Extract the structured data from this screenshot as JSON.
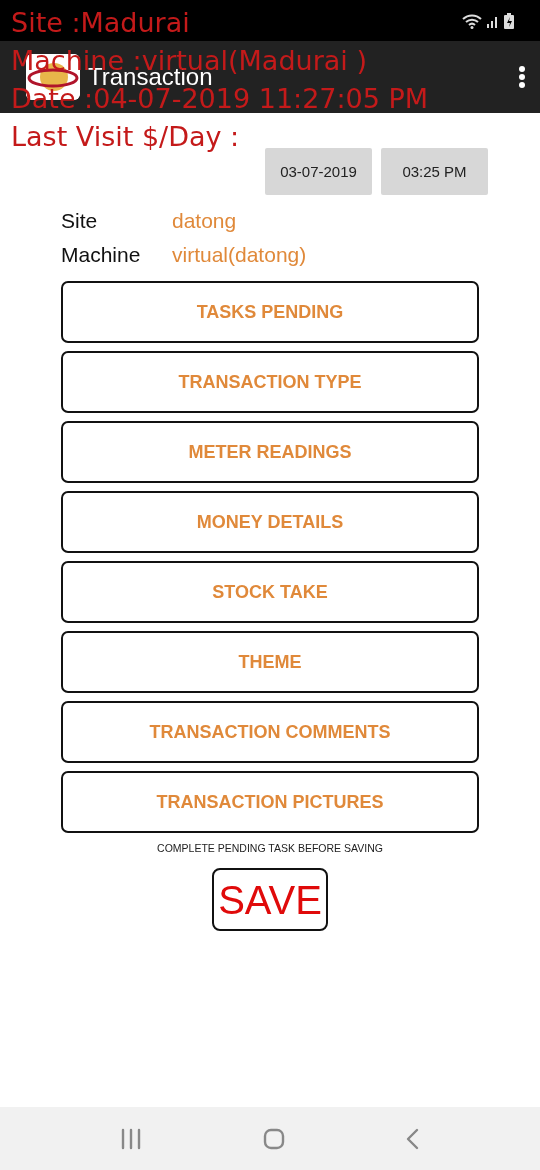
{
  "app_bar": {
    "title": "Transaction"
  },
  "overlay": [
    "Site :Madurai",
    "Machine :virtual(Madurai )",
    "Date :04-07-2019 11:27:05 PM",
    "Last Visit $/Day :"
  ],
  "last_visit": {
    "date": "03-07-2019",
    "time": "03:25 PM"
  },
  "info": [
    {
      "label": "Site",
      "value": "datong"
    },
    {
      "label": "Machine",
      "value": "virtual(datong)"
    }
  ],
  "menu": [
    "TASKS PENDING",
    "TRANSACTION TYPE",
    "METER READINGS",
    "MONEY DETAILS",
    "STOCK TAKE",
    "THEME",
    "TRANSACTION COMMENTS",
    "TRANSACTION PICTURES"
  ],
  "note": "COMPLETE PENDING TASK BEFORE SAVING",
  "save_button": "SAVE"
}
